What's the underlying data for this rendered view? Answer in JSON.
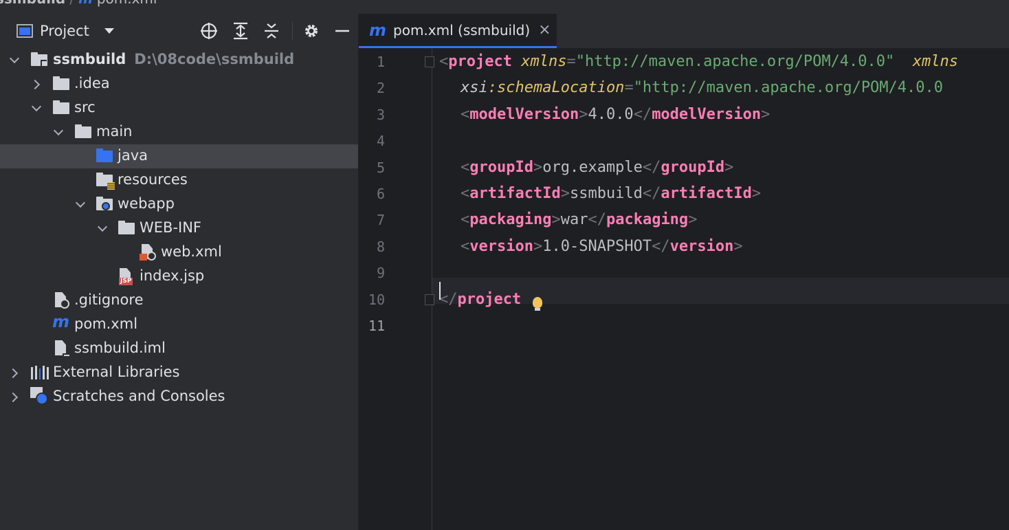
{
  "breadcrumb": {
    "project": "ssmbuild",
    "file": "pom.xml"
  },
  "project_panel": {
    "title": "Project",
    "tree": [
      {
        "label": "ssmbuild",
        "path": "D:\\08code\\ssmbuild"
      },
      {
        "label": ".idea"
      },
      {
        "label": "src"
      },
      {
        "label": "main"
      },
      {
        "label": "java"
      },
      {
        "label": "resources"
      },
      {
        "label": "webapp"
      },
      {
        "label": "WEB-INF"
      },
      {
        "label": "web.xml"
      },
      {
        "label": "index.jsp",
        "badge": "JSP"
      },
      {
        "label": ".gitignore"
      },
      {
        "label": "pom.xml",
        "icon_text": "m"
      },
      {
        "label": "ssmbuild.iml"
      },
      {
        "label": "External Libraries"
      },
      {
        "label": "Scratches and Consoles"
      }
    ]
  },
  "editor": {
    "tab": {
      "icon_text": "m",
      "label": "pom.xml (ssmbuild)",
      "close": "×"
    },
    "line_numbers": [
      "1",
      "2",
      "3",
      "4",
      "5",
      "6",
      "7",
      "8",
      "9",
      "10",
      "11"
    ],
    "code": {
      "l1": {
        "tag": "project",
        "attr1": "xmlns",
        "val1": "\"http://maven.apache.org/POM/4.0.0\"",
        "attr2": "xmlns"
      },
      "l2": {
        "ns": "xsi",
        "attr": "schemaLocation",
        "val": "\"http://maven.apache.org/POM/4.0.0"
      },
      "l3": {
        "tag": "modelVersion",
        "text": "4.0.0"
      },
      "l5": {
        "tag": "groupId",
        "text": "org.example"
      },
      "l6": {
        "tag": "artifactId",
        "text": "ssmbuild"
      },
      "l7": {
        "tag": "packaging",
        "text": "war"
      },
      "l8": {
        "tag": "version",
        "text": "1.0-SNAPSHOT"
      },
      "l10": {
        "tag": "project"
      }
    }
  },
  "colors": {
    "accent": "#3574f0",
    "tag": "#ff7eb6",
    "attribute": "#e0c46c",
    "string": "#6aab73",
    "background": "#1e1f22",
    "panel": "#2b2d30"
  }
}
